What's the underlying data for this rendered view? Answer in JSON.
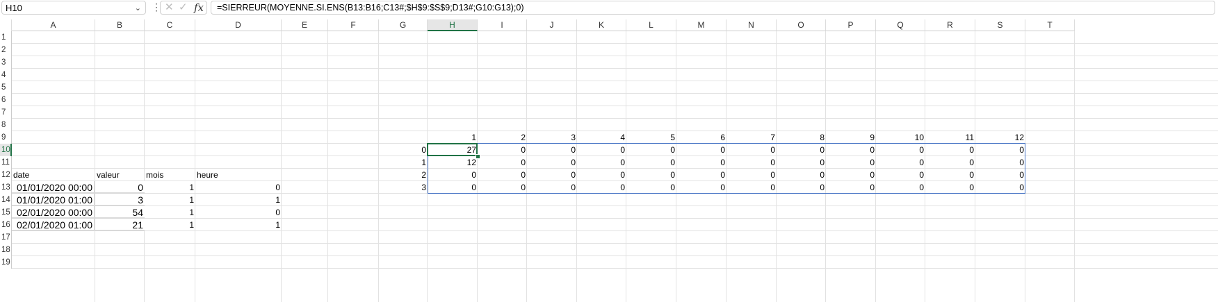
{
  "name_box": "H10",
  "formula": "=SIERREUR(MOYENNE.SI.ENS(B13:B16;C13#;$H$9:$S$9;D13#;G10:G13);0)",
  "fx_label": "fx",
  "columns": [
    "A",
    "B",
    "C",
    "D",
    "E",
    "F",
    "G",
    "H",
    "I",
    "J",
    "K",
    "L",
    "M",
    "N",
    "O",
    "P",
    "Q",
    "R",
    "S",
    "T"
  ],
  "rows": [
    "1",
    "2",
    "3",
    "4",
    "5",
    "6",
    "7",
    "8",
    "9",
    "10",
    "11",
    "12",
    "13",
    "14",
    "15",
    "16",
    "17",
    "18",
    "19"
  ],
  "active_cell": "H10",
  "headers": {
    "date": "date",
    "valeur": "valeur",
    "mois": "mois",
    "heure": "heure"
  },
  "table": [
    {
      "date": "01/01/2020 00:00",
      "valeur": "0",
      "mois": "1",
      "heure": "0"
    },
    {
      "date": "01/01/2020 01:00",
      "valeur": "3",
      "mois": "1",
      "heure": "1"
    },
    {
      "date": "02/01/2020 00:00",
      "valeur": "54",
      "mois": "1",
      "heure": "0"
    },
    {
      "date": "02/01/2020 01:00",
      "valeur": "21",
      "mois": "1",
      "heure": "1"
    }
  ],
  "month_headers": [
    "1",
    "2",
    "3",
    "4",
    "5",
    "6",
    "7",
    "8",
    "9",
    "10",
    "11",
    "12"
  ],
  "hour_labels": [
    "0",
    "1",
    "2",
    "3"
  ],
  "matrix": [
    [
      "27",
      "0",
      "0",
      "0",
      "0",
      "0",
      "0",
      "0",
      "0",
      "0",
      "0",
      "0"
    ],
    [
      "12",
      "0",
      "0",
      "0",
      "0",
      "0",
      "0",
      "0",
      "0",
      "0",
      "0",
      "0"
    ],
    [
      "0",
      "0",
      "0",
      "0",
      "0",
      "0",
      "0",
      "0",
      "0",
      "0",
      "0",
      "0"
    ],
    [
      "0",
      "0",
      "0",
      "0",
      "0",
      "0",
      "0",
      "0",
      "0",
      "0",
      "0",
      "0"
    ]
  ],
  "colors": {
    "active": "#217346",
    "spill": "#4472c4"
  }
}
